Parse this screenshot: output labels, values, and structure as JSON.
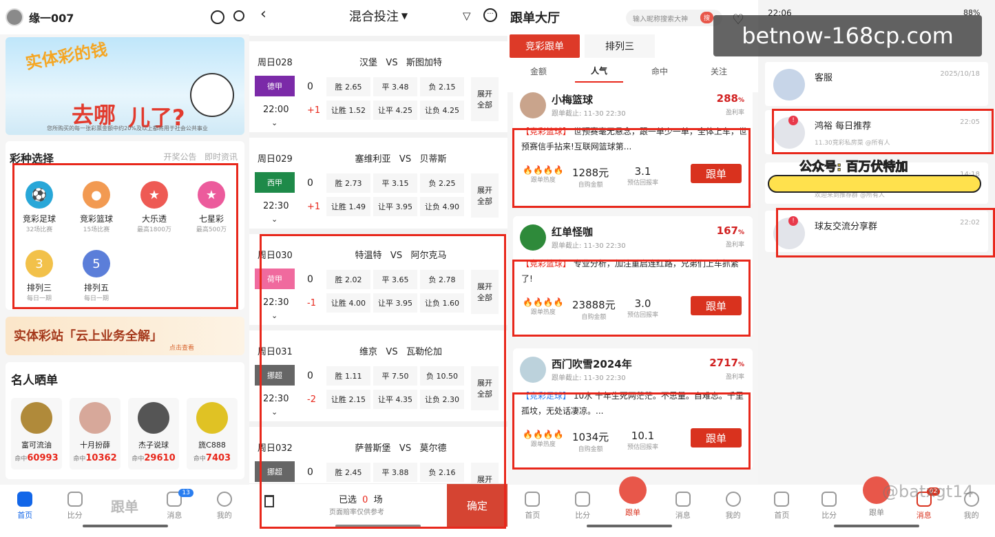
{
  "colors": {
    "accent": "#e8271b",
    "blue": "#1266e8",
    "brand_red": "#d9321e"
  },
  "p1": {
    "username": "缘一007",
    "banner": {
      "line1": "实体彩的钱",
      "line2": "去哪",
      "line3": "儿了?",
      "note": "您所购买的每一张彩票金额中约20%及以上都将用于社会公共事业"
    },
    "section_title": "彩种选择",
    "links": [
      "开奖公告",
      "即时资讯"
    ],
    "lotteries": [
      {
        "name": "竞彩足球",
        "desc": "32场比赛",
        "color": "#28a7d8",
        "icon": "soccer-ball"
      },
      {
        "name": "竞彩篮球",
        "desc": "15场比赛",
        "color": "#f29a52",
        "icon": "basketball"
      },
      {
        "name": "大乐透",
        "desc": "最高1800万",
        "color": "#ee5a54",
        "icon": "star"
      },
      {
        "name": "七星彩",
        "desc": "最高500万",
        "color": "#ec5b9c",
        "icon": "star"
      },
      {
        "name": "排列三",
        "desc": "每日一期",
        "color": "#f2c14a",
        "icon": "number-3"
      },
      {
        "name": "排列五",
        "desc": "每日一期",
        "color": "#5b7ed9",
        "icon": "number-5"
      }
    ],
    "promo": {
      "title": "实体彩站「云上业务全解」",
      "action": "点击查看"
    },
    "celebs_title": "名人晒单",
    "celebs": [
      {
        "name": "富可流油",
        "hit_label": "命中",
        "hit": "60993"
      },
      {
        "name": "十月扮薛",
        "hit_label": "命中",
        "hit": "10362"
      },
      {
        "name": "杰子说球",
        "hit_label": "命中",
        "hit": "29610"
      },
      {
        "name": "旒C888",
        "hit_label": "命中",
        "hit": "7403"
      }
    ],
    "tabs": [
      "首页",
      "比分",
      "跟单",
      "消息",
      "我的"
    ],
    "badge": "13"
  },
  "p2": {
    "title": "混合投注",
    "matches": [
      {
        "day": "周日028",
        "league": "德甲",
        "lcolor": "#7b2aa8",
        "time": "22:00",
        "home": "汉堡",
        "away": "斯图加特",
        "vs": "VS",
        "h0": "0",
        "h1": "+1",
        "odds": [
          "胜 2.65",
          "平 3.48",
          "负 2.15"
        ],
        "hodds": [
          "让胜 1.52",
          "让平 4.25",
          "让负 4.25"
        ]
      },
      {
        "day": "周日029",
        "league": "西甲",
        "lcolor": "#1e8a49",
        "time": "22:30",
        "home": "塞维利亚",
        "away": "贝蒂斯",
        "vs": "VS",
        "h0": "0",
        "h1": "+1",
        "odds": [
          "胜 2.73",
          "平 3.15",
          "负 2.25"
        ],
        "hodds": [
          "让胜 1.49",
          "让平 3.95",
          "让负 4.90"
        ]
      },
      {
        "day": "周日030",
        "league": "荷甲",
        "lcolor": "#f06a9e",
        "time": "22:30",
        "home": "特温特",
        "away": "阿尔克马",
        "vs": "VS",
        "h0": "0",
        "h1": "-1",
        "odds": [
          "胜 2.02",
          "平 3.65",
          "负 2.78"
        ],
        "hodds": [
          "让胜 4.00",
          "让平 3.95",
          "让负 1.60"
        ]
      },
      {
        "day": "周日031",
        "league": "挪超",
        "lcolor": "#666666",
        "time": "22:30",
        "home": "维京",
        "away": "瓦勒伦加",
        "vs": "VS",
        "h0": "0",
        "h1": "-2",
        "odds": [
          "胜 1.11",
          "平 7.50",
          "负 10.50"
        ],
        "hodds": [
          "让胜 2.15",
          "让平 4.35",
          "让负 2.30"
        ]
      },
      {
        "day": "周日032",
        "league": "挪超",
        "lcolor": "#666666",
        "time": "",
        "home": "萨普斯堡",
        "away": "莫尔德",
        "vs": "VS",
        "h0": "0",
        "h1": "",
        "odds": [
          "胜 2.45",
          "平 3.88",
          "负 2.16"
        ],
        "hodds": [
          "",
          "",
          ""
        ]
      }
    ],
    "expand": "展开全部",
    "selected": "已选",
    "count": "0",
    "unit": "场",
    "note": "页面赔率仅供参考",
    "confirm": "确定"
  },
  "p3": {
    "title": "跟单大厅",
    "search_placeholder": "输入昵称搜索大神",
    "search_btn": "搜",
    "tabs": [
      "竞彩跟单",
      "排列三"
    ],
    "filters": [
      "金额",
      "人气",
      "命中",
      "关注"
    ],
    "cards": [
      {
        "name": "小梅篮球",
        "deadline": "跟单截止: 11-30 22:30",
        "pct": "288",
        "pct_unit": "%",
        "pl": "盈利率",
        "tag": "【竞彩篮球】",
        "text": "世预赛毫无悬念，跟一单少一单，全体上车，世预赛信手拈来!互联网篮球第...",
        "heat_label": "跟单热度",
        "amount": "1288元",
        "amount_label": "自购金额",
        "rate": "3.1",
        "rate_label": "预估回报率",
        "btn": "跟单"
      },
      {
        "name": "红单怪咖",
        "deadline": "跟单截止: 11-30 22:30",
        "pct": "167",
        "pct_unit": "%",
        "pl": "盈利率",
        "tag": "【竞彩篮球】",
        "text": "专业分析，加注重启连红路，兄弟们上车抓紧了!",
        "heat_label": "跟单热度",
        "amount": "23888元",
        "amount_label": "自购金额",
        "rate": "3.0",
        "rate_label": "预估回报率",
        "btn": "跟单"
      },
      {
        "name": "西门吹雪2024年",
        "deadline": "跟单截止: 11-30 22:30",
        "pct": "2717",
        "pct_unit": "%",
        "pl": "盈利率",
        "tag": "【竞彩足球】",
        "text": "10水 十年生死两茫茫。不思量。自难忘。千里孤坟，无处话凄凉。...",
        "heat_label": "跟单热度",
        "amount": "1034元",
        "amount_label": "自购金额",
        "rate": "10.1",
        "rate_label": "预估回报率",
        "btn": "跟单"
      }
    ],
    "tabbar": [
      "首页",
      "比分",
      "跟单",
      "消息",
      "我的"
    ]
  },
  "p4": {
    "status_time": "22:06",
    "battery": "88%",
    "chats": [
      {
        "name": "客服",
        "time": "2025/10/18",
        "preview": ""
      },
      {
        "name": "鸿裕 每日推荐",
        "time": "22:05",
        "preview": "11.30竞彩私房菜 @所有人"
      },
      {
        "name": "",
        "time": "14:18",
        "preview": "欢迎来到推荐群 @所有人"
      },
      {
        "name": "球友交流分享群",
        "time": "22:02",
        "preview": ""
      }
    ],
    "overlay": "公众号: 百万伏特加",
    "tabbar": [
      "首页",
      "比分",
      "跟单",
      "消息",
      "我的"
    ],
    "badge": "02",
    "watermark_bottom": "@batxgt14"
  },
  "watermark": "betnow-168cp.com"
}
